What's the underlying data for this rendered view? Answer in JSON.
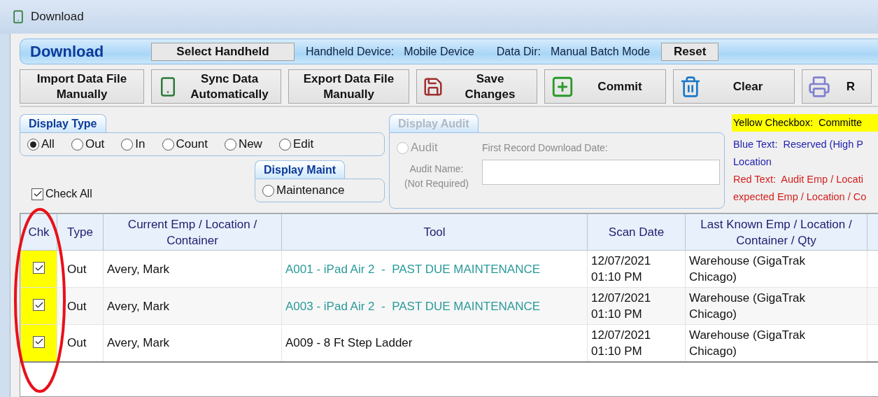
{
  "window": {
    "title": "Download"
  },
  "header": {
    "title": "Download",
    "select_button": "Select Handheld",
    "device_label": "Handheld Device:",
    "device_value": "Mobile Device",
    "dir_label": "Data Dir:",
    "dir_value": "Manual Batch Mode",
    "reset_button": "Reset"
  },
  "toolbar": [
    {
      "label": "Import Data File Manually",
      "kind": "text"
    },
    {
      "label": "Sync Data Automatically",
      "kind": "phone"
    },
    {
      "label": "Export Data File Manually",
      "kind": "text"
    },
    {
      "label": "Save Changes",
      "kind": "save"
    },
    {
      "label": "Commit",
      "kind": "commit"
    },
    {
      "label": "Clear",
      "kind": "clear"
    },
    {
      "label": "R",
      "kind": "print"
    }
  ],
  "display_type": {
    "title": "Display Type",
    "options": [
      {
        "label": "All",
        "selected": true
      },
      {
        "label": "Out",
        "selected": false
      },
      {
        "label": "In",
        "selected": false
      },
      {
        "label": "Count",
        "selected": false
      },
      {
        "label": "New",
        "selected": false
      },
      {
        "label": "Edit",
        "selected": false
      }
    ]
  },
  "display_maint": {
    "title": "Display Maint",
    "option": {
      "label": "Maintenance",
      "selected": false
    }
  },
  "check_all": {
    "label": "Check All",
    "checked": true
  },
  "display_audit": {
    "title": "Display Audit",
    "disabled": true,
    "audit_option": {
      "label": "Audit",
      "selected": false
    },
    "first_record_label": "First Record Download Date:",
    "audit_name_label": "Audit Name:",
    "audit_name_hint": "(Not Required)"
  },
  "legend": [
    {
      "text": "Yellow Checkbox:  Committe",
      "highlight": true
    },
    {
      "text": "Blue Text:  Reserved (High P",
      "color": "#2222b0",
      "highlight": false
    },
    {
      "text": "Location",
      "color": "#2222b0",
      "highlight": false
    },
    {
      "text": "Red Text:  Audit Emp / Locati",
      "color": "#d42020",
      "highlight": false
    },
    {
      "text": "expected Emp / Location / Co",
      "color": "#d42020",
      "highlight": false
    }
  ],
  "table": {
    "columns": [
      "Chk",
      "Type",
      "Current Emp / Location / Container",
      "Tool",
      "Scan Date",
      "Last Known Emp / Location / Container / Qty"
    ],
    "rows": [
      {
        "checked": true,
        "committed": true,
        "type": "Out",
        "emp": "Avery, Mark",
        "tool": "A001 - iPad Air 2  -  PAST DUE MAINTENANCE",
        "past_due": true,
        "scan_date": "12/07/2021",
        "scan_time": "01:10 PM",
        "last_known": "Warehouse (GigaTrak Chicago)"
      },
      {
        "checked": true,
        "committed": true,
        "type": "Out",
        "emp": "Avery, Mark",
        "tool": "A003 - iPad Air 2  -  PAST DUE MAINTENANCE",
        "past_due": true,
        "scan_date": "12/07/2021",
        "scan_time": "01:10 PM",
        "last_known": "Warehouse (GigaTrak Chicago)"
      },
      {
        "checked": true,
        "committed": true,
        "type": "Out",
        "emp": "Avery, Mark",
        "tool": "A009 - 8 Ft Step Ladder",
        "past_due": false,
        "scan_date": "12/07/2021",
        "scan_time": "01:10 PM",
        "last_known": "Warehouse (GigaTrak Chicago)"
      }
    ]
  },
  "annotation": {
    "kind": "ellipse",
    "color": "#e8101a"
  }
}
